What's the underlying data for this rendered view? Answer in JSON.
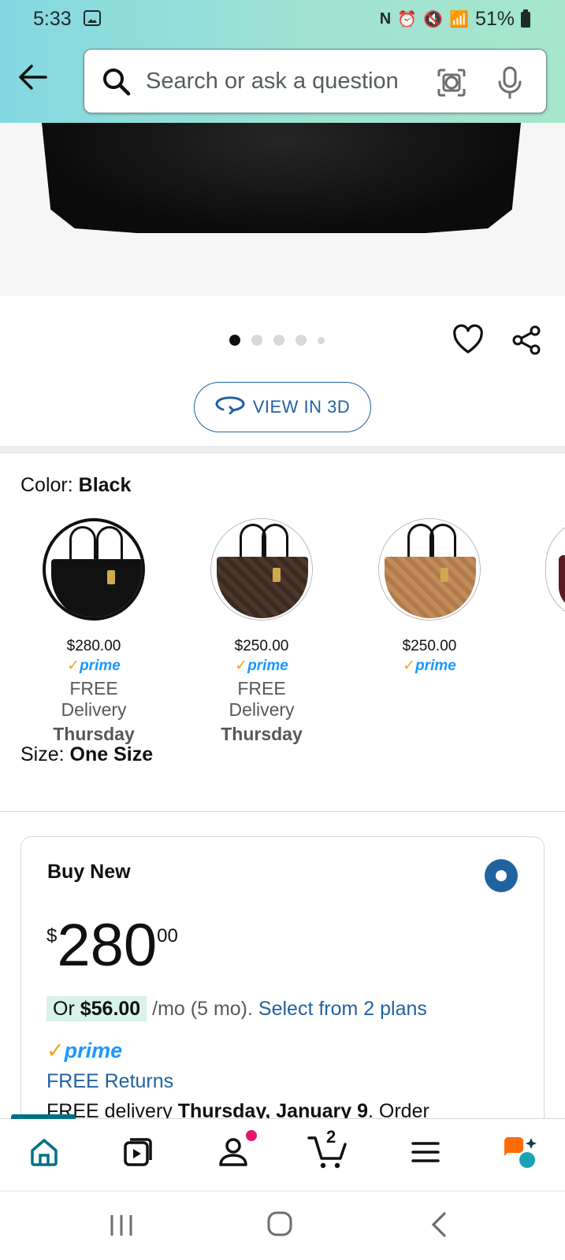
{
  "status_bar": {
    "time": "5:33",
    "battery": "51%"
  },
  "search": {
    "placeholder": "Search or ask a question"
  },
  "gallery": {
    "dots": 5,
    "active_index": 0
  },
  "view_3d_label": "VIEW IN 3D",
  "color": {
    "label": "Color:",
    "selected": "Black"
  },
  "swatches": [
    {
      "price": "$280.00",
      "prime": "prime",
      "delivery": "FREE Delivery",
      "day": "Thursday",
      "color_hex": "#111111"
    },
    {
      "price": "$250.00",
      "prime": "prime",
      "delivery": "FREE Delivery",
      "day": "Thursday",
      "color_hex": "#3a2a22"
    },
    {
      "price": "$250.00",
      "prime": "prime",
      "delivery": "",
      "day": "",
      "color_hex": "#b07a4a"
    }
  ],
  "size": {
    "label": "Size:",
    "selected": "One Size"
  },
  "buy_box": {
    "title": "Buy New",
    "currency": "$",
    "price_whole": "280",
    "price_fraction": "00",
    "plan_prefix": "Or",
    "plan_amount": "$56.00",
    "plan_suffix": "/mo (5 mo).",
    "plan_link": "Select from 2 plans",
    "prime": "prime",
    "free_returns": "FREE Returns",
    "delivery_prefix": "FREE delivery",
    "delivery_date": "Thursday, January 9",
    "delivery_suffix": ". Order"
  },
  "nav": {
    "cart_count": "2"
  },
  "colors": {
    "accent": "#2162a1",
    "prime_blue": "#1a98ff",
    "prime_check": "#f7a21b",
    "header_teal": "#84d8e1"
  }
}
